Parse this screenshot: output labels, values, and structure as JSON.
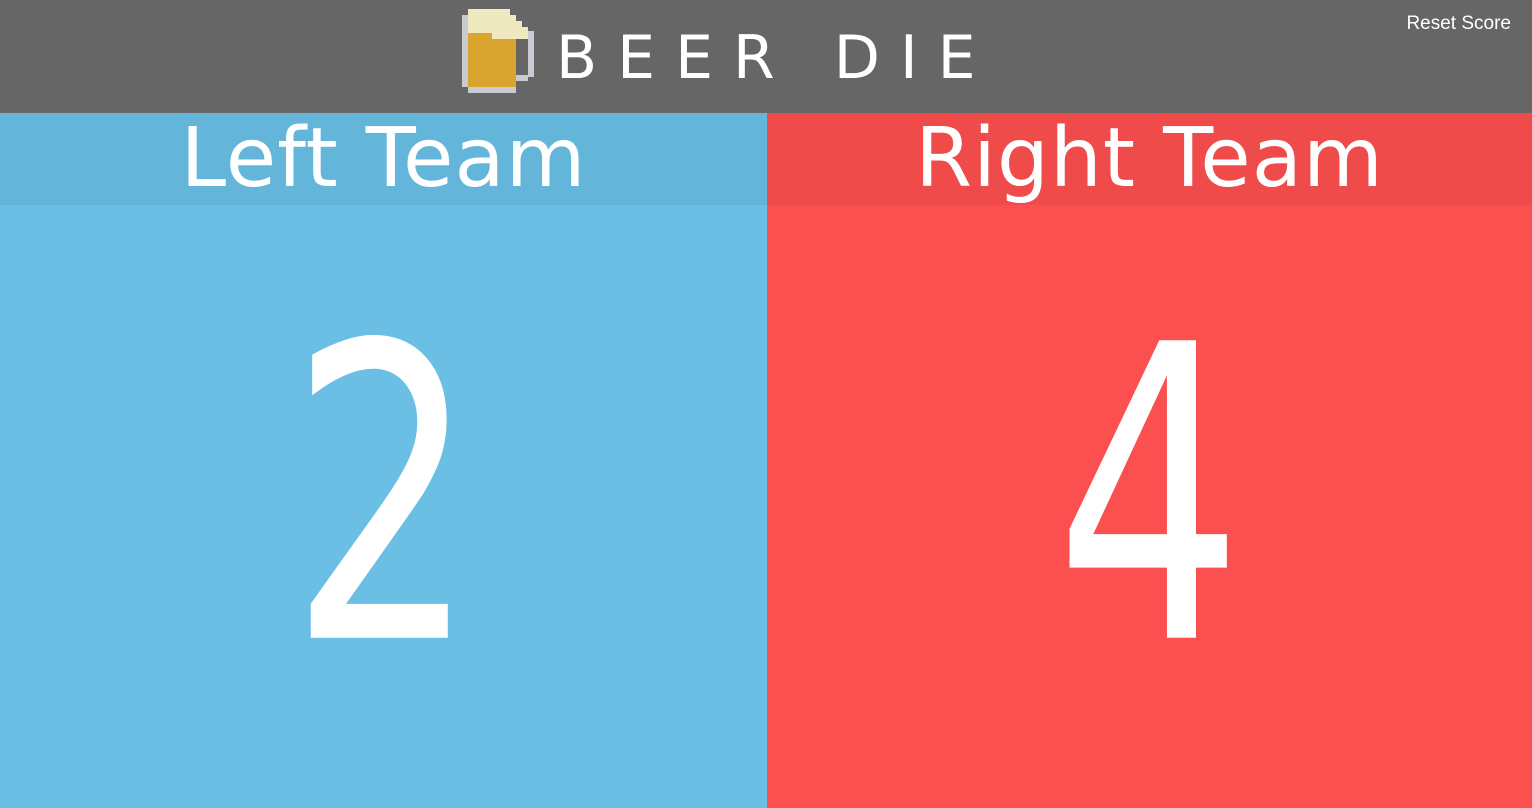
{
  "header": {
    "logo_icon": "beer-mug-icon",
    "title": "BEER DIE",
    "reset_label": "Reset Score",
    "background": "#666666"
  },
  "teams": {
    "left": {
      "name": "Left Team",
      "score": "2",
      "color": "#6bbfe4",
      "header_color": "#64b5da"
    },
    "right": {
      "name": "Right Team",
      "score": "4",
      "color": "#fc5050",
      "header_color": "#ef4b4b"
    }
  }
}
